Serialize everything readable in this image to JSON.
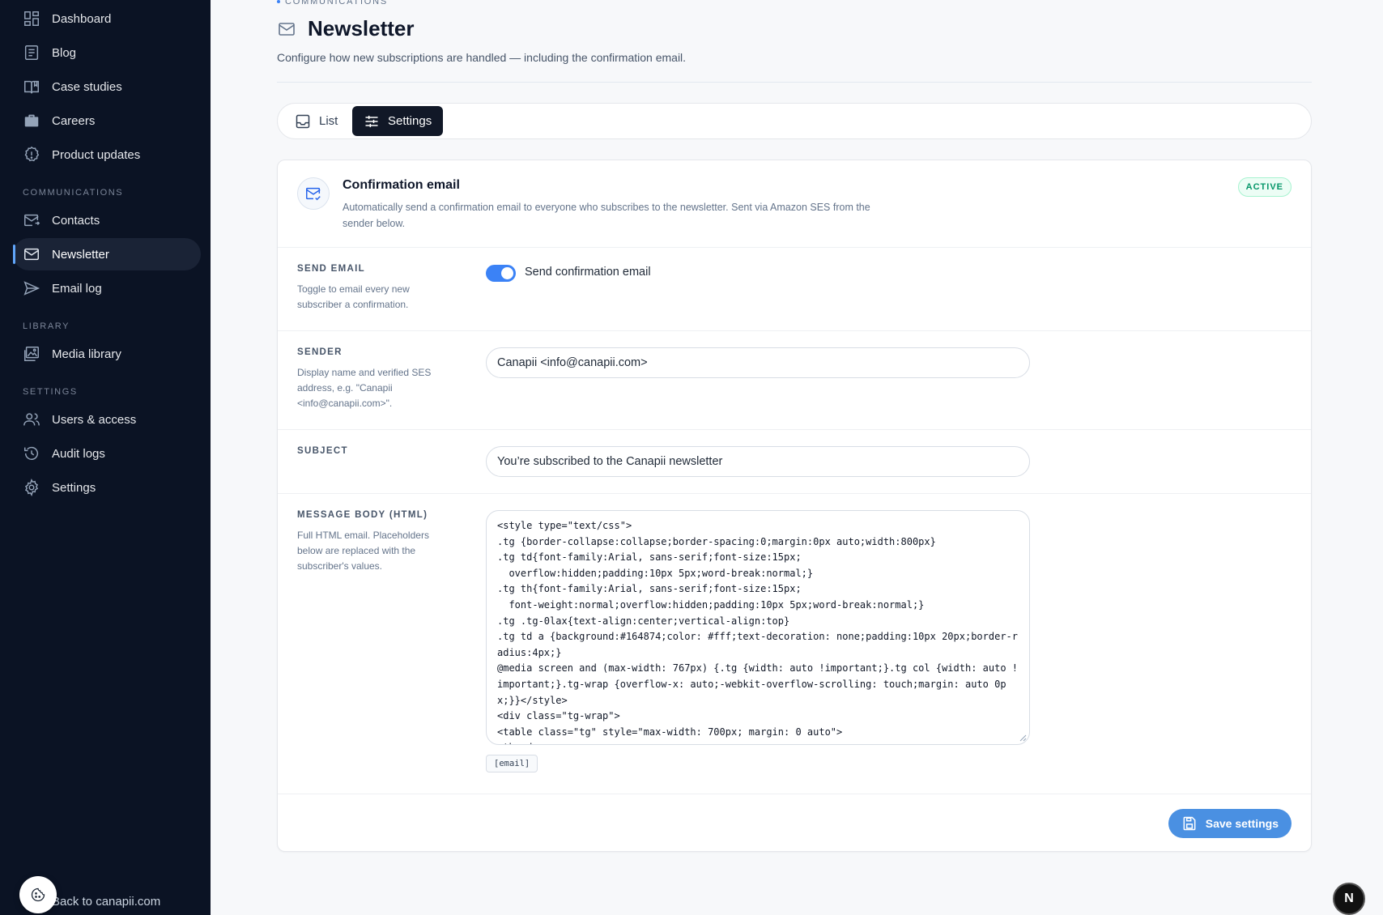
{
  "sidebar": {
    "items_top": [
      {
        "label": "Dashboard",
        "icon": "dashboard-icon"
      },
      {
        "label": "Blog",
        "icon": "blog-icon"
      },
      {
        "label": "Case studies",
        "icon": "book-icon"
      },
      {
        "label": "Careers",
        "icon": "briefcase-icon"
      },
      {
        "label": "Product updates",
        "icon": "badge-icon"
      }
    ],
    "section_communications": "COMMUNICATIONS",
    "items_comm": [
      {
        "label": "Contacts",
        "icon": "contacts-mail-icon"
      },
      {
        "label": "Newsletter",
        "icon": "mail-icon"
      },
      {
        "label": "Email log",
        "icon": "send-icon"
      }
    ],
    "section_library": "LIBRARY",
    "items_library": [
      {
        "label": "Media library",
        "icon": "image-icon"
      }
    ],
    "section_settings": "SETTINGS",
    "items_settings": [
      {
        "label": "Users & access",
        "icon": "users-icon"
      },
      {
        "label": "Audit logs",
        "icon": "history-icon"
      },
      {
        "label": "Settings",
        "icon": "gear-icon"
      }
    ],
    "back_link": "Back to canapii.com"
  },
  "header": {
    "eyebrow": "COMMUNICATIONS",
    "title": "Newsletter",
    "subtitle": "Configure how new subscriptions are handled — including the confirmation email."
  },
  "tabs": [
    {
      "label": "List",
      "active": false
    },
    {
      "label": "Settings",
      "active": true
    }
  ],
  "card": {
    "title": "Confirmation email",
    "description": "Automatically send a confirmation email to everyone who subscribes to the newsletter. Sent via Amazon SES from the sender below.",
    "status": "ACTIVE",
    "send_email": {
      "label": "SEND EMAIL",
      "hint": "Toggle to email every new subscriber a confirmation.",
      "toggle_label": "Send confirmation email",
      "enabled": true
    },
    "sender": {
      "label": "SENDER",
      "hint": "Display name and verified SES address, e.g. \"Canapii <info@canapii.com>\".",
      "value": "Canapii <info@canapii.com>"
    },
    "subject": {
      "label": "SUBJECT",
      "value": "You’re subscribed to the Canapii newsletter"
    },
    "body": {
      "label": "MESSAGE BODY (HTML)",
      "hint": "Full HTML email. Placeholders below are replaced with the subscriber's values.",
      "value": "<style type=\"text/css\">\n.tg {border-collapse:collapse;border-spacing:0;margin:0px auto;width:800px}\n.tg td{font-family:Arial, sans-serif;font-size:15px;\n  overflow:hidden;padding:10px 5px;word-break:normal;}\n.tg th{font-family:Arial, sans-serif;font-size:15px;\n  font-weight:normal;overflow:hidden;padding:10px 5px;word-break:normal;}\n.tg .tg-0lax{text-align:center;vertical-align:top}\n.tg td a {background:#164874;color: #fff;text-decoration: none;padding:10px 20px;border-radius:4px;}\n@media screen and (max-width: 767px) {.tg {width: auto !important;}.tg col {width: auto !important;}.tg-wrap {overflow-x: auto;-webkit-overflow-scrolling: touch;margin: auto 0px;}}</style>\n<div class=\"tg-wrap\">\n<table class=\"tg\" style=\"max-width: 700px; margin: 0 auto\">\n<thead>",
      "placeholder_chip": "[email]"
    },
    "save_label": "Save settings"
  },
  "corner_badge": "N",
  "colors": {
    "sidebar_bg": "#0b1324",
    "accent": "#3b82f6",
    "save_button": "#4a90e2",
    "active_badge": "#059669"
  }
}
